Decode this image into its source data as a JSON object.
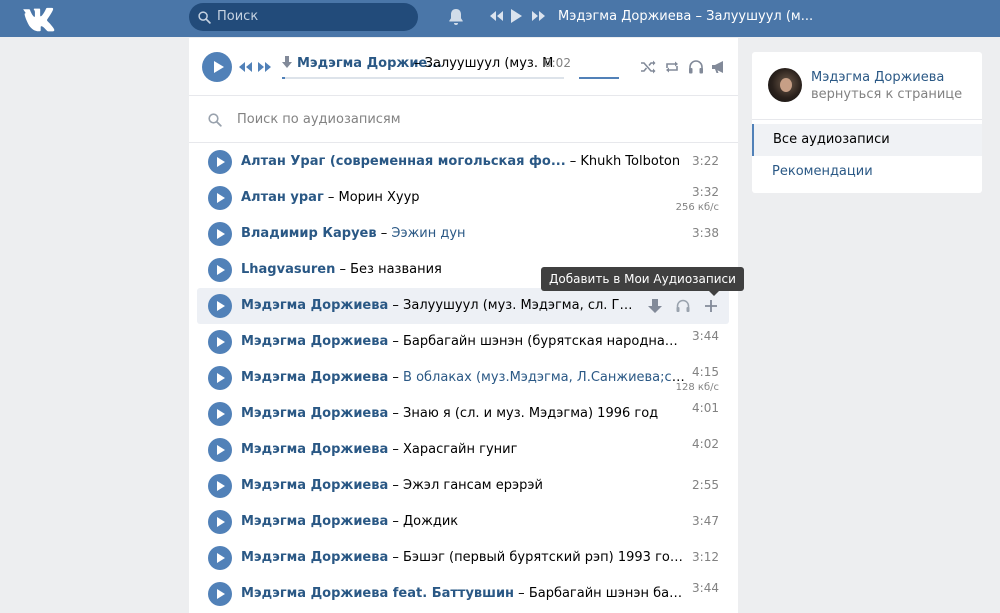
{
  "topbar": {
    "search_placeholder": "Поиск",
    "now_playing": "Мэдэгма Доржиева – Залуушуул (м..."
  },
  "player": {
    "artist": "Мэдэгма Доржие...",
    "title": "– Залуушуул (муз. М",
    "time": "0:02",
    "progress": 0.01
  },
  "audio_search": {
    "placeholder": "Поиск по аудиозаписям"
  },
  "tracks": [
    {
      "artist": "Алтан Ураг (современная могольская фо...",
      "title": "Khukh Tolboton",
      "duration": "3:22",
      "kbps": ""
    },
    {
      "artist": "Алтан ураг",
      "title": "Морин Хуур",
      "duration": "3:32",
      "kbps": "256 кб/с"
    },
    {
      "artist": "Владимир Каруев",
      "title": "Ээжин дун",
      "duration": "3:38",
      "kbps": ""
    },
    {
      "artist": "Lhagvasuren",
      "title": "Без названия",
      "duration": "",
      "kbps": ""
    },
    {
      "artist": "Мэдэгма Доржиева",
      "title": "Залуушуул (муз. Мэдэгма, сл. Гымаа)",
      "duration": "",
      "kbps": ""
    },
    {
      "artist": "Мэдэгма Доржиева",
      "title": "Барбагайн шэнэн (бурятская народная песня, об...",
      "duration": "3:44",
      "kbps": ""
    },
    {
      "artist": "Мэдэгма Доржиева",
      "title": "В облаках (муз.Мэдэгма, Л.Санжиева;сл.Т.Баже...",
      "duration": "4:15",
      "kbps": "128 кб/с"
    },
    {
      "artist": "Мэдэгма Доржиева",
      "title": "Знаю я (сл. и муз. Мэдэгма) 1996 год",
      "duration": "4:01",
      "kbps": ""
    },
    {
      "artist": "Мэдэгма Доржиева",
      "title": "Харасгайн гуниг",
      "duration": "4:02",
      "kbps": ""
    },
    {
      "artist": "Мэдэгма Доржиева",
      "title": "Эжэл гансам ерэрэй",
      "duration": "2:55",
      "kbps": ""
    },
    {
      "artist": "Мэдэгма Доржиева",
      "title": "Дождик",
      "duration": "3:47",
      "kbps": ""
    },
    {
      "artist": "Мэдэгма Доржиева",
      "title": "Бэшэг (первый бурятский рэп) 1993 год (produc...",
      "duration": "3:12",
      "kbps": ""
    },
    {
      "artist": "Мэдэгма Доржиева feat. Баттувшин",
      "title": "Барбагайн шэнэн байхадам (со...",
      "duration": "3:44",
      "kbps": ""
    }
  ],
  "tooltip": "Добавить в Мои Аудиозаписи",
  "side": {
    "user_name": "Мэдэгма Доржиева",
    "back_link": "вернуться к странице",
    "nav_all": "Все аудиозаписи",
    "nav_recs": "Рекомендации"
  },
  "colors": {
    "brand": "#4a76a8",
    "link": "#2a5885",
    "accent": "#5181b8"
  }
}
